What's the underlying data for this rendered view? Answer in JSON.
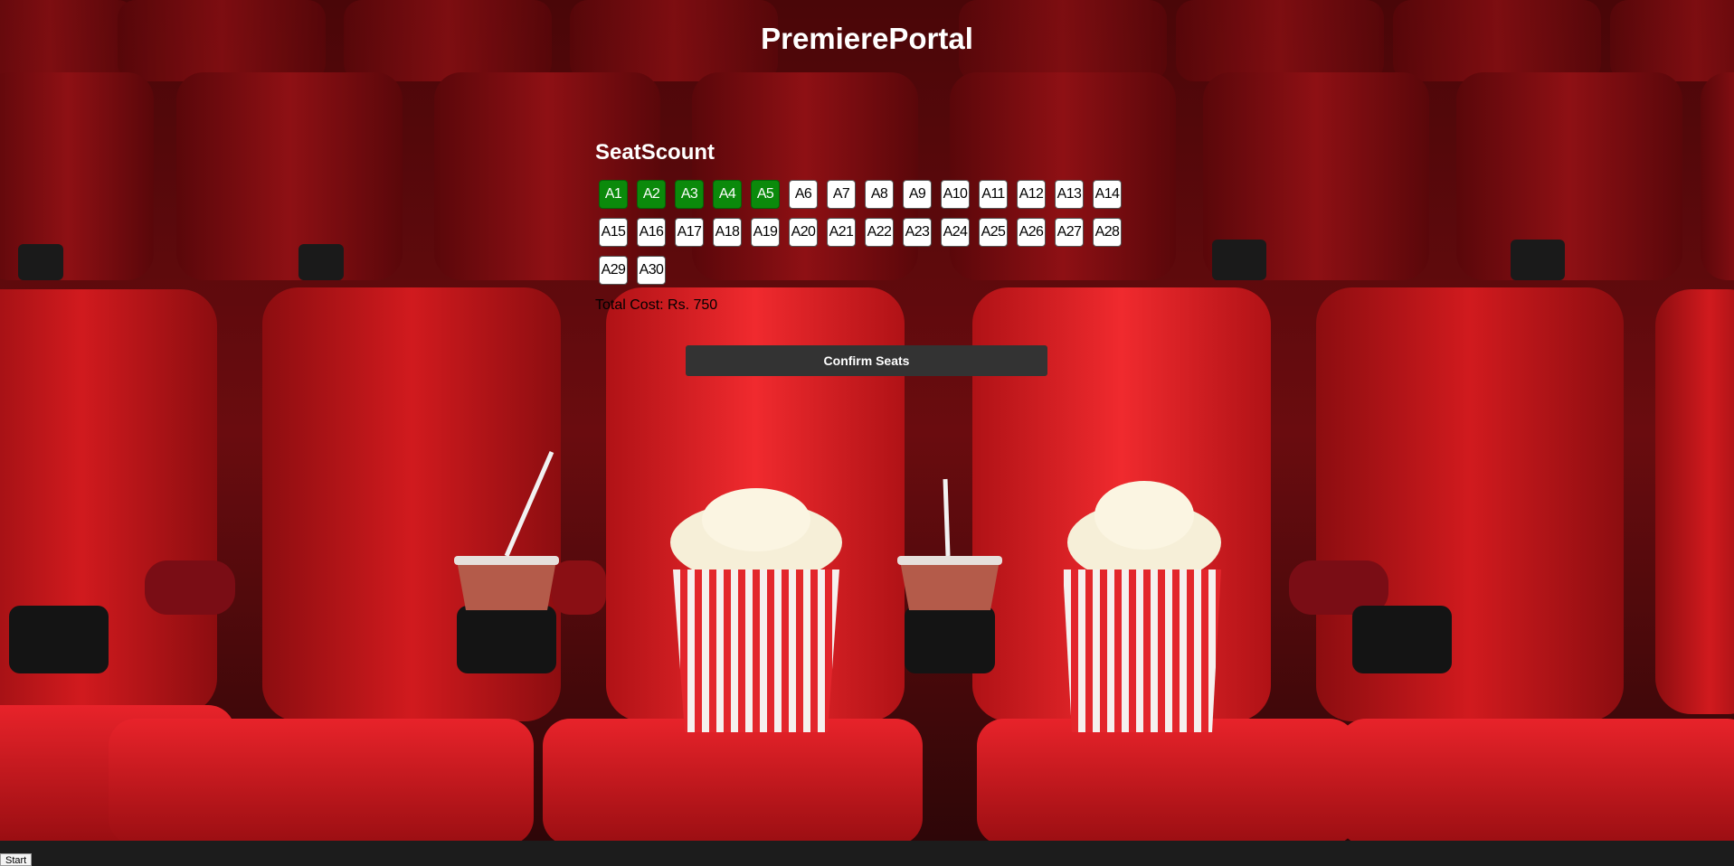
{
  "app": {
    "title": "PremierePortal"
  },
  "booking": {
    "title": "SeatScount",
    "seats": [
      {
        "label": "A1",
        "selected": true
      },
      {
        "label": "A2",
        "selected": true
      },
      {
        "label": "A3",
        "selected": true
      },
      {
        "label": "A4",
        "selected": true
      },
      {
        "label": "A5",
        "selected": true
      },
      {
        "label": "A6",
        "selected": false
      },
      {
        "label": "A7",
        "selected": false
      },
      {
        "label": "A8",
        "selected": false
      },
      {
        "label": "A9",
        "selected": false
      },
      {
        "label": "A10",
        "selected": false
      },
      {
        "label": "A11",
        "selected": false
      },
      {
        "label": "A12",
        "selected": false
      },
      {
        "label": "A13",
        "selected": false
      },
      {
        "label": "A14",
        "selected": false
      },
      {
        "label": "A15",
        "selected": false
      },
      {
        "label": "A16",
        "selected": false
      },
      {
        "label": "A17",
        "selected": false
      },
      {
        "label": "A18",
        "selected": false
      },
      {
        "label": "A19",
        "selected": false
      },
      {
        "label": "A20",
        "selected": false
      },
      {
        "label": "A21",
        "selected": false
      },
      {
        "label": "A22",
        "selected": false
      },
      {
        "label": "A23",
        "selected": false
      },
      {
        "label": "A24",
        "selected": false
      },
      {
        "label": "A25",
        "selected": false
      },
      {
        "label": "A26",
        "selected": false
      },
      {
        "label": "A27",
        "selected": false
      },
      {
        "label": "A28",
        "selected": false
      },
      {
        "label": "A29",
        "selected": false
      },
      {
        "label": "A30",
        "selected": false
      }
    ],
    "total_cost_text": "Total Cost: Rs. 750",
    "confirm_label": "Confirm Seats"
  },
  "taskbar": {
    "start_label": "Start"
  },
  "colors": {
    "selected_seat": "#0b8a0b",
    "available_seat": "#ffffff",
    "confirm_button": "#333333"
  },
  "background": {
    "image": "cinema-seats-with-popcorn-and-drinks"
  }
}
